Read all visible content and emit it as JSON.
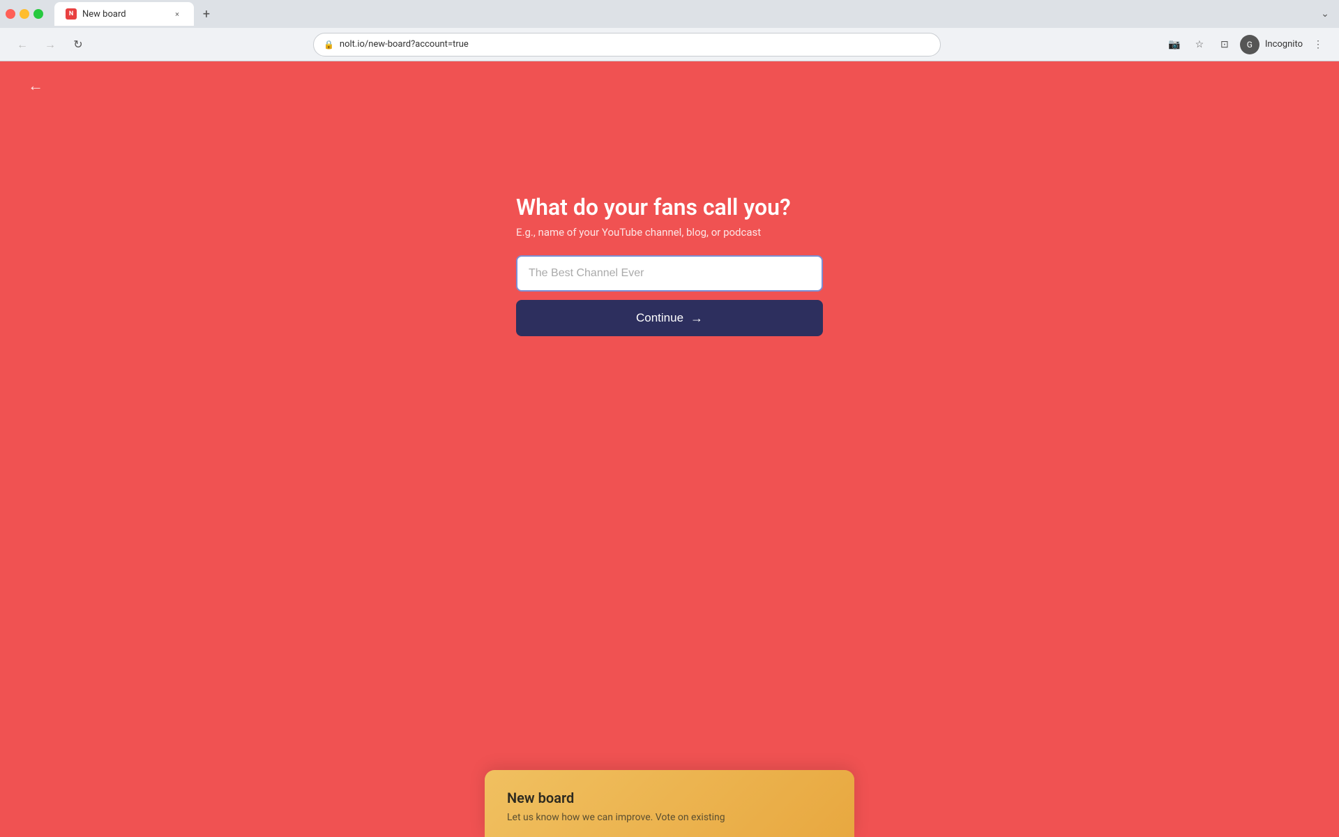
{
  "browser": {
    "tab": {
      "favicon_label": "N",
      "title": "New board",
      "close_label": "×"
    },
    "new_tab_label": "+",
    "expand_label": "⌄",
    "toolbar": {
      "back_label": "←",
      "forward_label": "→",
      "reload_label": "↻",
      "address": "nolt.io/new-board?account=true",
      "lock_icon": "🔒",
      "camera_off_icon": "📷",
      "star_icon": "☆",
      "split_icon": "⊡",
      "profile_label": "G",
      "incognito_label": "Incognito",
      "menu_icon": "⋮"
    }
  },
  "page": {
    "back_arrow": "←",
    "heading": "What do your fans call you?",
    "subtext": "E.g., name of your YouTube channel, blog, or podcast",
    "input_placeholder": "The Best Channel Ever",
    "continue_button_label": "Continue",
    "continue_arrow": "→"
  },
  "preview_card": {
    "title": "New board",
    "description": "Let us know how we can improve. Vote on existing"
  }
}
